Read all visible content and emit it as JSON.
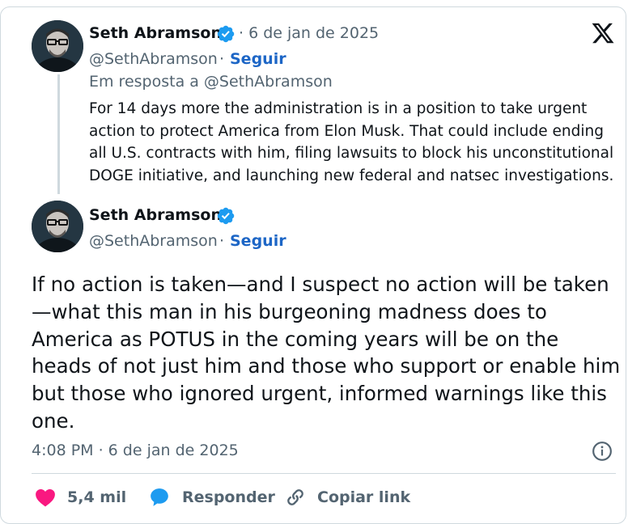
{
  "brand": {
    "logo": "x-logo",
    "accent": "#1d9bf0",
    "follow_color": "#1d66c6",
    "like_color": "#f91880"
  },
  "parent_tweet": {
    "author_name": "Seth Abramson",
    "verified": true,
    "date": "· 6 de jan de 2025",
    "handle": "@SethAbramson",
    "separator": "·",
    "follow_label": "Seguir",
    "reply_to": "Em resposta a @SethAbramson",
    "text": "For 14 days more the administration is in a position to take urgent action to protect America from Elon Musk. That could include ending all U.S. contracts with him, filing lawsuits to block his unconstitutional DOGE initiative, and launching new federal and natsec investigations."
  },
  "main_tweet": {
    "author_name": "Seth Abramson",
    "verified": true,
    "handle": "@SethAbramson",
    "separator": "·",
    "follow_label": "Seguir",
    "text": "If no action is taken—and I suspect no action will be taken—what this man in his burgeoning madness does to America as POTUS in the coming years will be on the heads of not just him and those who support or enable him but those who ignored urgent, informed warnings like this one.",
    "timestamp": "4:08 PM · 6 de jan de 2025"
  },
  "actions": {
    "likes": "5,4 mil",
    "reply_label": "Responder",
    "copy_link_label": "Copiar link"
  }
}
